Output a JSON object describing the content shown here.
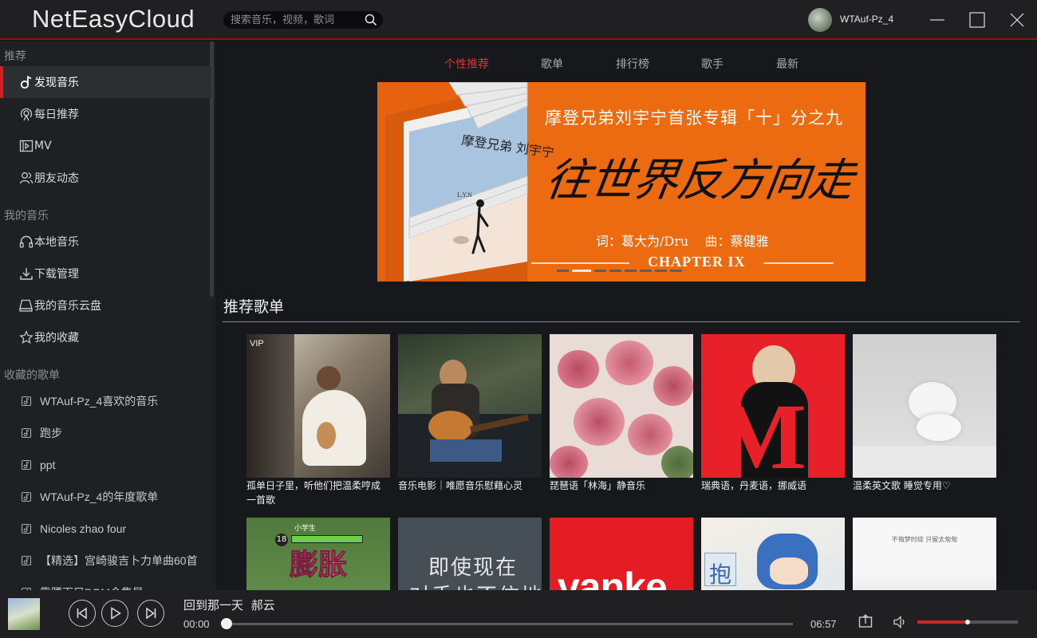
{
  "app": {
    "title": "NetEasyCloud"
  },
  "search": {
    "placeholder": "搜索音乐，视频，歌词"
  },
  "user": {
    "name": "WTAuf-Pz_4"
  },
  "sidebar": {
    "sections": [
      {
        "title": "推荐",
        "items": [
          {
            "label": "发现音乐",
            "icon": "music-note-icon",
            "active": true
          },
          {
            "label": "每日推荐",
            "icon": "radio-icon"
          },
          {
            "label": "MV",
            "icon": "film-icon"
          },
          {
            "label": "朋友动态",
            "icon": "friends-icon"
          }
        ]
      },
      {
        "title": "我的音乐",
        "items": [
          {
            "label": "本地音乐",
            "icon": "headphones-icon"
          },
          {
            "label": "下载管理",
            "icon": "download-icon"
          },
          {
            "label": "我的音乐云盘",
            "icon": "cloud-drive-icon"
          },
          {
            "label": "我的收藏",
            "icon": "star-icon"
          }
        ]
      },
      {
        "title": "收藏的歌单",
        "playlists": [
          "WTAuf-Pz_4喜欢的音乐",
          "跑步",
          "ppt",
          "WTAuf-Pz_4的年度歌单",
          "Nicoles zhao four",
          "【精选】宫崎骏吉卜力单曲60首",
          "靠腰下只BGM合集是"
        ]
      }
    ]
  },
  "tabs": [
    {
      "label": "个性推荐",
      "active": true
    },
    {
      "label": "歌单"
    },
    {
      "label": "排行榜"
    },
    {
      "label": "歌手"
    },
    {
      "label": "最新"
    }
  ],
  "banner": {
    "headline": "摩登兄弟刘宇宁首张专辑「十」分之九",
    "calligraphy": "往世界反方向走",
    "credits": "词：葛大为/Dru    曲：蔡健雅",
    "chapter": "CHAPTER IX",
    "album_signature": "摩登兄弟 刘宇宁",
    "album_sub": "L.Y.N",
    "dot_count": 8,
    "active_dot": 1
  },
  "recommended": {
    "title": "推荐歌单",
    "cards": [
      {
        "title": "孤单日子里，听他们把温柔哼成一首歌",
        "badge": "VIP"
      },
      {
        "title": "音乐电影｜唯愿音乐慰藉心灵",
        "badge": ""
      },
      {
        "title": "琵琶语「林海」静音乐",
        "badge": ""
      },
      {
        "title": "瑞典语，丹麦语，挪威语",
        "badge": ""
      },
      {
        "title": "温柔英文歌 睡觉专用♡",
        "badge": ""
      }
    ],
    "second_row_text": [
      "膨胀",
      "18",
      "小学生",
      "即使现在",
      "对手也不信地",
      "vanke",
      "抱",
      "不侮梦时绽 只留太匆匆"
    ]
  },
  "player": {
    "song": "回到那一天",
    "artist": "郝云",
    "current_time": "00:00",
    "total_time": "06:57",
    "progress": 0.0,
    "volume": 0.5
  },
  "colors": {
    "accent": "#d81e1e",
    "banner": "#ec6b11",
    "sidebar": "#1f2023",
    "main": "#16181c"
  }
}
